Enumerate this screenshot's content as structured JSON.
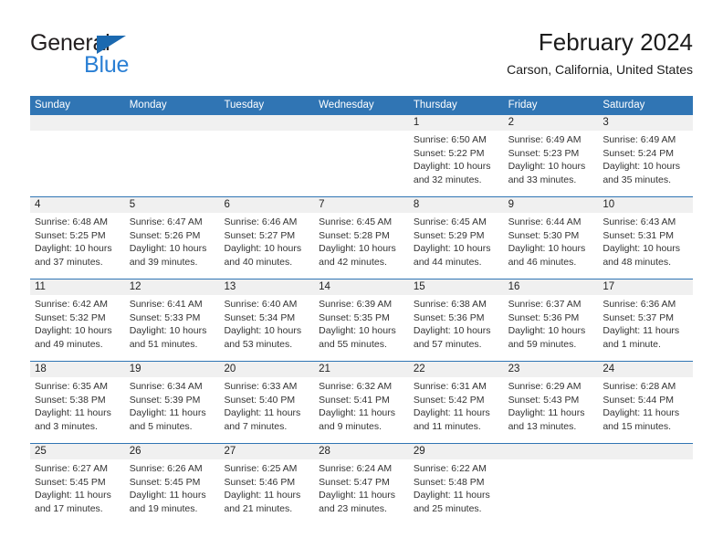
{
  "brand": {
    "name_top": "General",
    "name_bottom": "Blue",
    "accent_dark": "#1b69b0",
    "accent_light": "#2a7fd4"
  },
  "header": {
    "title": "February 2024",
    "subtitle": "Carson, California, United States"
  },
  "theme": {
    "header_blue": "#3075b4",
    "daynum_band": "#f0f0f0",
    "text": "#222222"
  },
  "weekdays": [
    "Sunday",
    "Monday",
    "Tuesday",
    "Wednesday",
    "Thursday",
    "Friday",
    "Saturday"
  ],
  "weeks": [
    [
      {
        "day": "",
        "lines": []
      },
      {
        "day": "",
        "lines": []
      },
      {
        "day": "",
        "lines": []
      },
      {
        "day": "",
        "lines": []
      },
      {
        "day": "1",
        "lines": [
          "Sunrise: 6:50 AM",
          "Sunset: 5:22 PM",
          "Daylight: 10 hours",
          "and 32 minutes."
        ]
      },
      {
        "day": "2",
        "lines": [
          "Sunrise: 6:49 AM",
          "Sunset: 5:23 PM",
          "Daylight: 10 hours",
          "and 33 minutes."
        ]
      },
      {
        "day": "3",
        "lines": [
          "Sunrise: 6:49 AM",
          "Sunset: 5:24 PM",
          "Daylight: 10 hours",
          "and 35 minutes."
        ]
      }
    ],
    [
      {
        "day": "4",
        "lines": [
          "Sunrise: 6:48 AM",
          "Sunset: 5:25 PM",
          "Daylight: 10 hours",
          "and 37 minutes."
        ]
      },
      {
        "day": "5",
        "lines": [
          "Sunrise: 6:47 AM",
          "Sunset: 5:26 PM",
          "Daylight: 10 hours",
          "and 39 minutes."
        ]
      },
      {
        "day": "6",
        "lines": [
          "Sunrise: 6:46 AM",
          "Sunset: 5:27 PM",
          "Daylight: 10 hours",
          "and 40 minutes."
        ]
      },
      {
        "day": "7",
        "lines": [
          "Sunrise: 6:45 AM",
          "Sunset: 5:28 PM",
          "Daylight: 10 hours",
          "and 42 minutes."
        ]
      },
      {
        "day": "8",
        "lines": [
          "Sunrise: 6:45 AM",
          "Sunset: 5:29 PM",
          "Daylight: 10 hours",
          "and 44 minutes."
        ]
      },
      {
        "day": "9",
        "lines": [
          "Sunrise: 6:44 AM",
          "Sunset: 5:30 PM",
          "Daylight: 10 hours",
          "and 46 minutes."
        ]
      },
      {
        "day": "10",
        "lines": [
          "Sunrise: 6:43 AM",
          "Sunset: 5:31 PM",
          "Daylight: 10 hours",
          "and 48 minutes."
        ]
      }
    ],
    [
      {
        "day": "11",
        "lines": [
          "Sunrise: 6:42 AM",
          "Sunset: 5:32 PM",
          "Daylight: 10 hours",
          "and 49 minutes."
        ]
      },
      {
        "day": "12",
        "lines": [
          "Sunrise: 6:41 AM",
          "Sunset: 5:33 PM",
          "Daylight: 10 hours",
          "and 51 minutes."
        ]
      },
      {
        "day": "13",
        "lines": [
          "Sunrise: 6:40 AM",
          "Sunset: 5:34 PM",
          "Daylight: 10 hours",
          "and 53 minutes."
        ]
      },
      {
        "day": "14",
        "lines": [
          "Sunrise: 6:39 AM",
          "Sunset: 5:35 PM",
          "Daylight: 10 hours",
          "and 55 minutes."
        ]
      },
      {
        "day": "15",
        "lines": [
          "Sunrise: 6:38 AM",
          "Sunset: 5:36 PM",
          "Daylight: 10 hours",
          "and 57 minutes."
        ]
      },
      {
        "day": "16",
        "lines": [
          "Sunrise: 6:37 AM",
          "Sunset: 5:36 PM",
          "Daylight: 10 hours",
          "and 59 minutes."
        ]
      },
      {
        "day": "17",
        "lines": [
          "Sunrise: 6:36 AM",
          "Sunset: 5:37 PM",
          "Daylight: 11 hours",
          "and 1 minute."
        ]
      }
    ],
    [
      {
        "day": "18",
        "lines": [
          "Sunrise: 6:35 AM",
          "Sunset: 5:38 PM",
          "Daylight: 11 hours",
          "and 3 minutes."
        ]
      },
      {
        "day": "19",
        "lines": [
          "Sunrise: 6:34 AM",
          "Sunset: 5:39 PM",
          "Daylight: 11 hours",
          "and 5 minutes."
        ]
      },
      {
        "day": "20",
        "lines": [
          "Sunrise: 6:33 AM",
          "Sunset: 5:40 PM",
          "Daylight: 11 hours",
          "and 7 minutes."
        ]
      },
      {
        "day": "21",
        "lines": [
          "Sunrise: 6:32 AM",
          "Sunset: 5:41 PM",
          "Daylight: 11 hours",
          "and 9 minutes."
        ]
      },
      {
        "day": "22",
        "lines": [
          "Sunrise: 6:31 AM",
          "Sunset: 5:42 PM",
          "Daylight: 11 hours",
          "and 11 minutes."
        ]
      },
      {
        "day": "23",
        "lines": [
          "Sunrise: 6:29 AM",
          "Sunset: 5:43 PM",
          "Daylight: 11 hours",
          "and 13 minutes."
        ]
      },
      {
        "day": "24",
        "lines": [
          "Sunrise: 6:28 AM",
          "Sunset: 5:44 PM",
          "Daylight: 11 hours",
          "and 15 minutes."
        ]
      }
    ],
    [
      {
        "day": "25",
        "lines": [
          "Sunrise: 6:27 AM",
          "Sunset: 5:45 PM",
          "Daylight: 11 hours",
          "and 17 minutes."
        ]
      },
      {
        "day": "26",
        "lines": [
          "Sunrise: 6:26 AM",
          "Sunset: 5:45 PM",
          "Daylight: 11 hours",
          "and 19 minutes."
        ]
      },
      {
        "day": "27",
        "lines": [
          "Sunrise: 6:25 AM",
          "Sunset: 5:46 PM",
          "Daylight: 11 hours",
          "and 21 minutes."
        ]
      },
      {
        "day": "28",
        "lines": [
          "Sunrise: 6:24 AM",
          "Sunset: 5:47 PM",
          "Daylight: 11 hours",
          "and 23 minutes."
        ]
      },
      {
        "day": "29",
        "lines": [
          "Sunrise: 6:22 AM",
          "Sunset: 5:48 PM",
          "Daylight: 11 hours",
          "and 25 minutes."
        ]
      },
      {
        "day": "",
        "lines": []
      },
      {
        "day": "",
        "lines": []
      }
    ]
  ]
}
